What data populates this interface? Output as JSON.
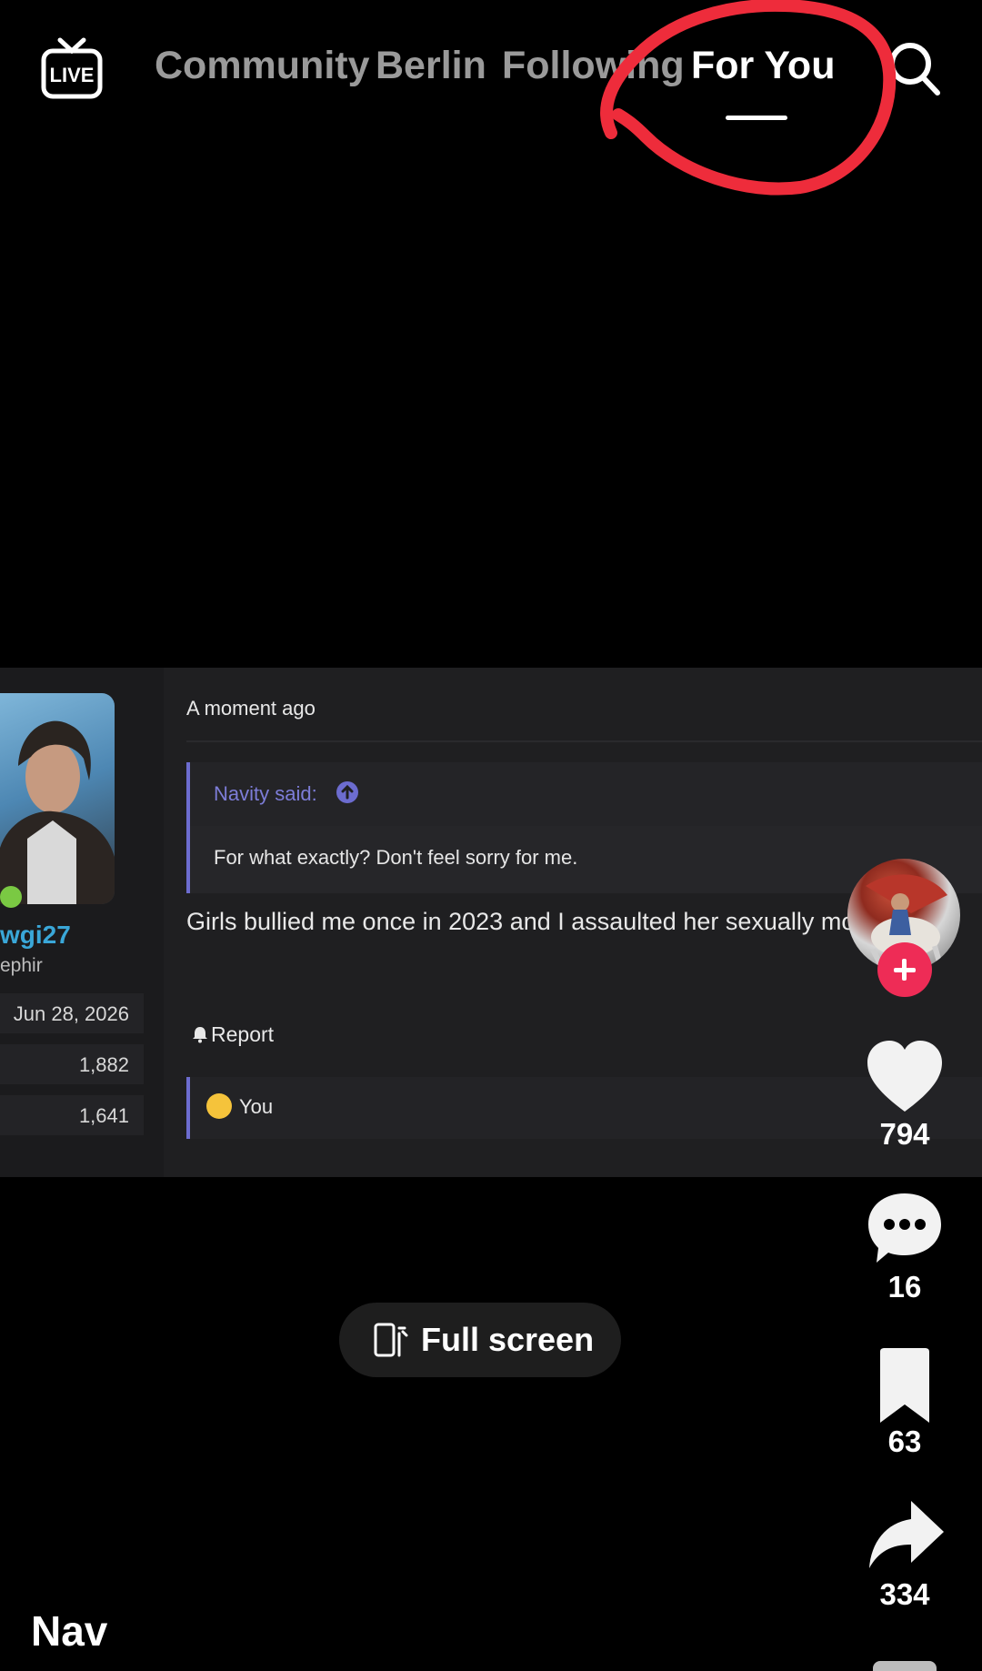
{
  "topbar": {
    "tabs": [
      "Community",
      "Berlin",
      "Following",
      "For You"
    ],
    "active_tab": "For You",
    "icons": [
      "live-tv-icon",
      "search-icon"
    ]
  },
  "post": {
    "user": {
      "username": "wgi27",
      "title": "ephir",
      "joined": "Jun 28, 2026",
      "messages": "1,882",
      "reactions": "1,641"
    },
    "timestamp": "A moment ago",
    "quote": {
      "author": "Navity said:",
      "text": "For what exactly? Don't feel sorry for me."
    },
    "body": "Girls bullied me once in 2023 and I assaulted her sexually mo",
    "report_label": "Report",
    "reaction": {
      "emoji": "joy-emoji",
      "label": "You"
    }
  },
  "rail": {
    "likes": "794",
    "comments": "16",
    "saves": "63",
    "shares": "334"
  },
  "fullscreen_label": "Full screen",
  "nav_label": "Nav",
  "colors": {
    "annotation": "#ee2c3b",
    "follow": "#ee2c56",
    "username": "#3aa7d8",
    "quote_accent": "#6c6ccf"
  }
}
